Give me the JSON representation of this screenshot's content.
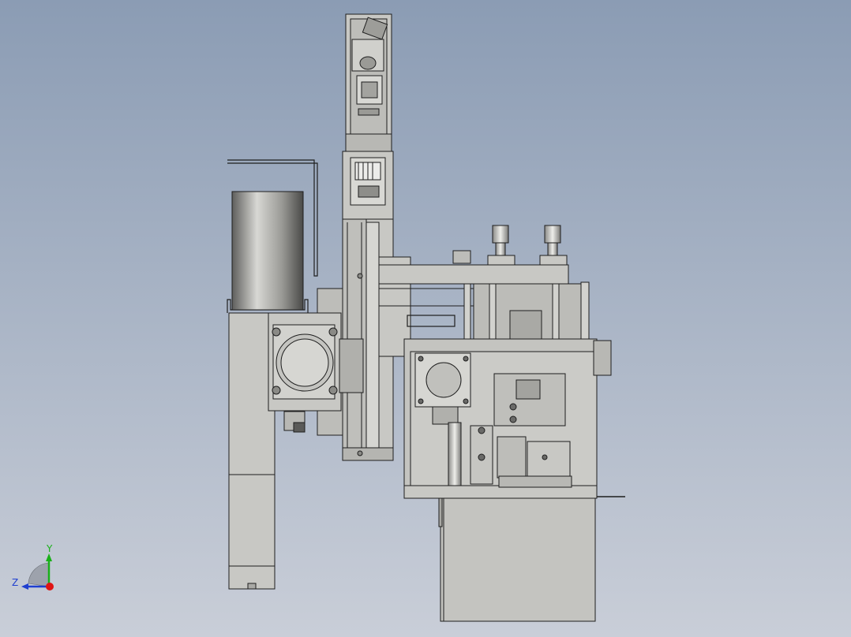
{
  "viewport": {
    "background_top": "#8b9cb4",
    "background_bottom": "#c9ced8",
    "part_fill": "#c8c8c4",
    "part_fill_dark": "#a9a9a5",
    "edge_color": "#1e1e1e"
  },
  "triad": {
    "y_label": "Y",
    "z_label": "Z",
    "y_color": "#19b019",
    "z_color": "#1f3fd0",
    "x_color": "#e01414"
  }
}
